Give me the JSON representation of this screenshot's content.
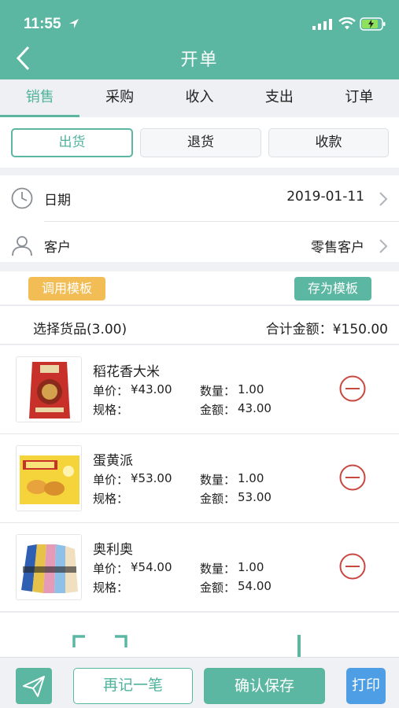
{
  "status_bar": {
    "time": "11:55"
  },
  "header": {
    "title": "开单"
  },
  "tabs": [
    {
      "label": "销售",
      "active": true
    },
    {
      "label": "采购",
      "active": false
    },
    {
      "label": "收入",
      "active": false
    },
    {
      "label": "支出",
      "active": false
    },
    {
      "label": "订单",
      "active": false
    }
  ],
  "segment": [
    {
      "label": "出货",
      "active": true
    },
    {
      "label": "退货",
      "active": false
    },
    {
      "label": "收款",
      "active": false
    }
  ],
  "date_row": {
    "label": "日期",
    "value": "2019-01-11"
  },
  "customer_row": {
    "label": "客户",
    "value": "零售客户"
  },
  "templates": {
    "load_label": "调用模板",
    "save_label": "存为模板"
  },
  "summary": {
    "selected_label": "选择货品(3.00)",
    "total_label": "合计金额：¥150.00"
  },
  "field_labels": {
    "price": "单价：",
    "qty": "数量：",
    "spec": "规格：",
    "amount": "金额："
  },
  "items": [
    {
      "name": "稻花香大米",
      "price": "¥43.00",
      "qty": "1.00",
      "spec": "",
      "amount": "43.00"
    },
    {
      "name": "蛋黄派",
      "price": "¥53.00",
      "qty": "1.00",
      "spec": "",
      "amount": "53.00"
    },
    {
      "name": "奥利奥",
      "price": "¥54.00",
      "qty": "1.00",
      "spec": "",
      "amount": "54.00"
    }
  ],
  "bottom": {
    "again_label": "再记一笔",
    "save_label": "确认保存",
    "print_label": "打印"
  },
  "colors": {
    "accent": "#5bb7a2",
    "orange": "#f2bd55",
    "danger": "#c8473e",
    "print": "#4e9ee6"
  }
}
